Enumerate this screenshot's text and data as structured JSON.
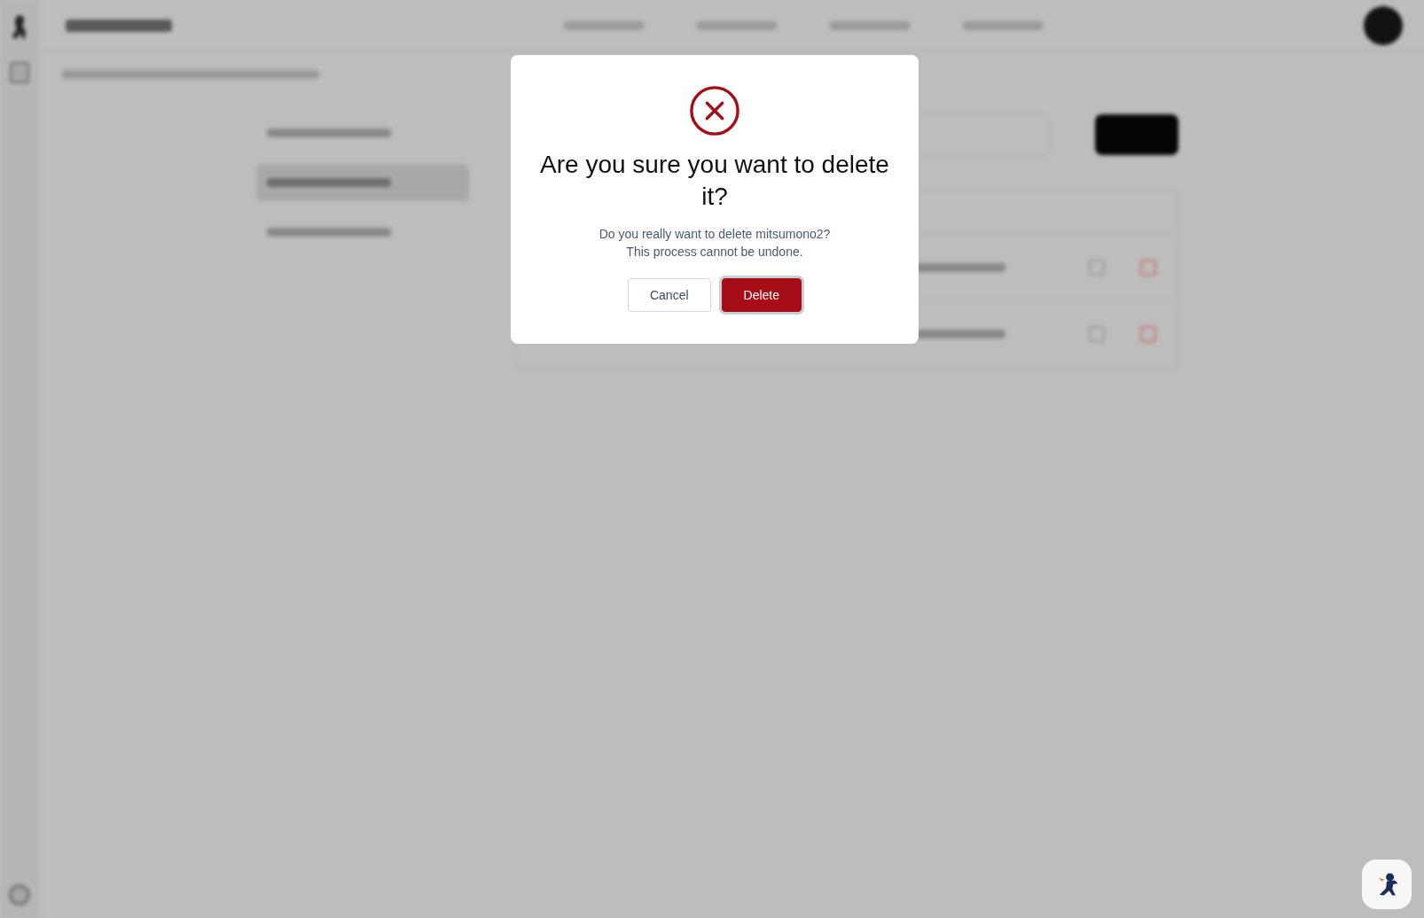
{
  "sidebar": {
    "items": [
      {
        "selected": false
      },
      {
        "selected": true
      },
      {
        "selected": false
      }
    ]
  },
  "dialog": {
    "title": "Are you sure you want to delete it?",
    "message_lines": [
      "Do you really want to delete mitsumono2?",
      "This process cannot be undone."
    ],
    "buttons": [
      {
        "label": "Cancel",
        "kind": "secondary",
        "focused": false
      },
      {
        "label": "Delete",
        "kind": "danger",
        "focused": true
      }
    ]
  }
}
